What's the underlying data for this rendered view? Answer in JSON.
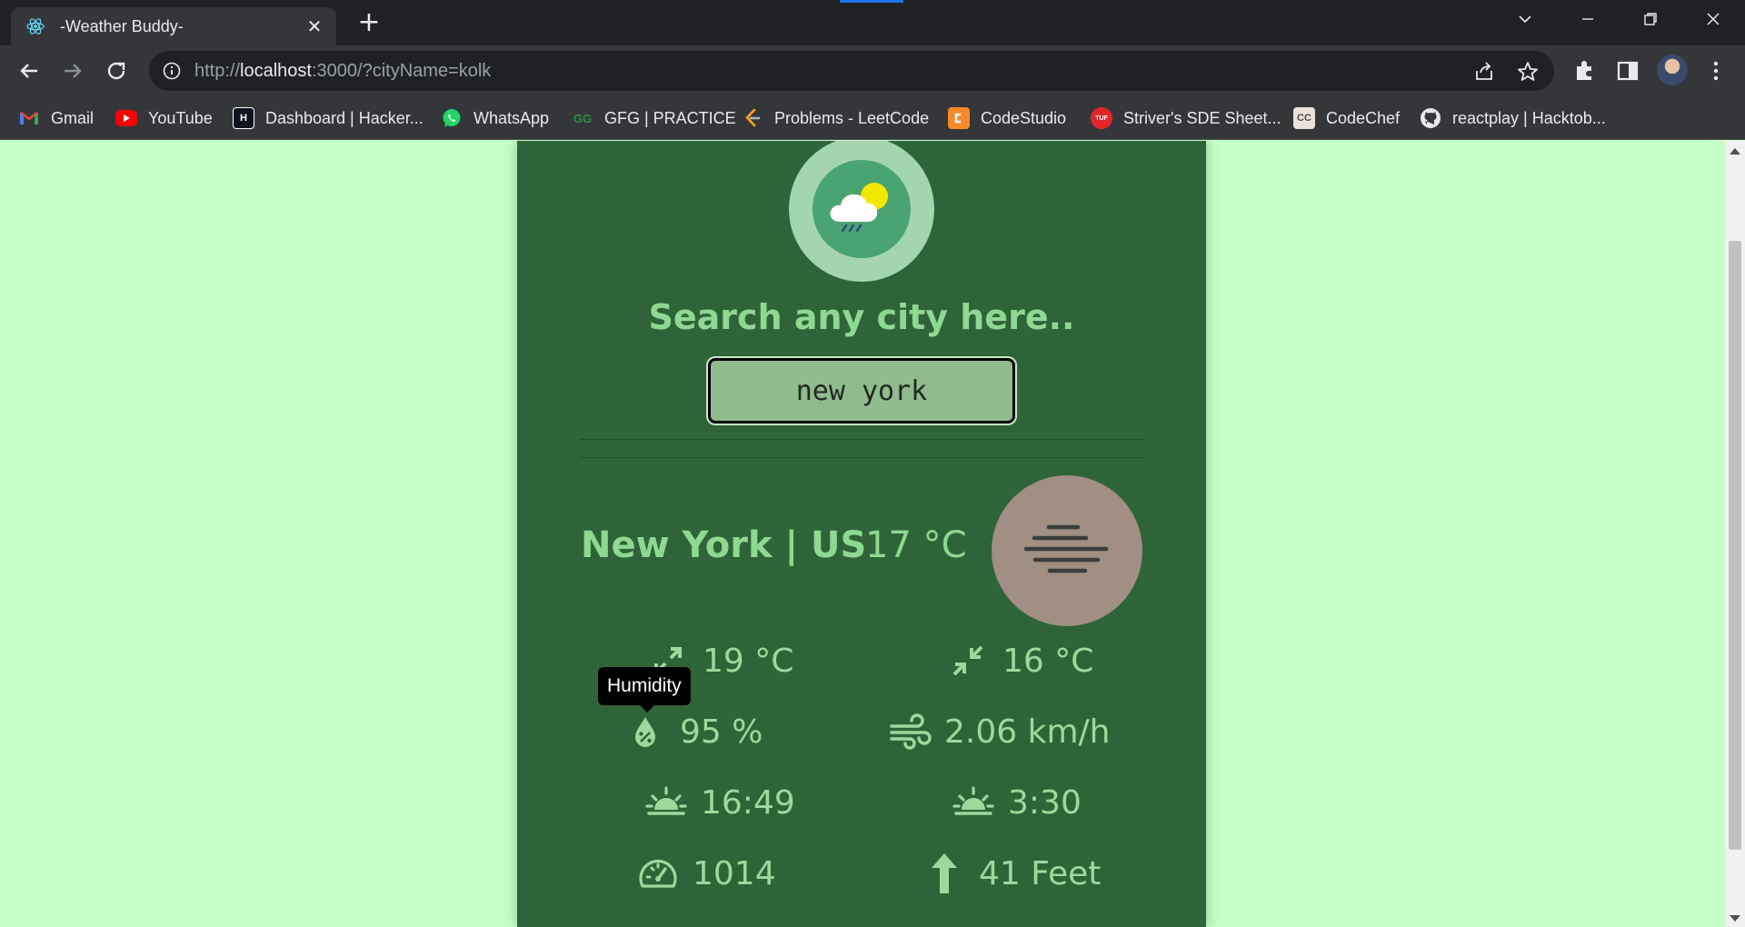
{
  "browser": {
    "tab_title": "-Weather Buddy-",
    "tab_close": "✕",
    "new_tab": "+",
    "url_prefix": "http://",
    "url_host": "localhost",
    "url_rest": ":3000/?cityName=kolk",
    "accent_color": "#1a73e8",
    "window_controls": [
      "minimize",
      "restore",
      "close"
    ]
  },
  "bookmarks": [
    {
      "label": "Gmail",
      "icon": "gmail-icon"
    },
    {
      "label": "YouTube",
      "icon": "youtube-icon"
    },
    {
      "label": "Dashboard | Hacker...",
      "icon": "hackerrank-icon",
      "icon_text": "H"
    },
    {
      "label": "WhatsApp",
      "icon": "whatsapp-icon"
    },
    {
      "label": "GFG | PRACTICE",
      "icon": "gfg-icon",
      "icon_text": "GG"
    },
    {
      "label": "Problems - LeetCode",
      "icon": "leetcode-icon"
    },
    {
      "label": "CodeStudio",
      "icon": "codestudio-icon"
    },
    {
      "label": "Striver's SDE Sheet...",
      "icon": "tuf-icon",
      "icon_text": "TUF"
    },
    {
      "label": "CodeChef",
      "icon": "codechef-icon",
      "icon_text": "CC"
    },
    {
      "label": "reactplay | Hacktob...",
      "icon": "github-icon"
    }
  ],
  "app": {
    "search_title": "Search any city here..",
    "search_value": "new york",
    "city": "New York | US",
    "temperature": "17 °C",
    "weather_icon": "mist-icon",
    "tooltip": "Humidity",
    "stats": {
      "temp_max": "19 °C",
      "temp_min": "16 °C",
      "humidity": "95 %",
      "wind": "2.06 km/h",
      "sunrise": "16:49",
      "sunset": "3:30",
      "pressure": "1014",
      "sea_level": "41 Feet"
    },
    "colors": {
      "page_bg": "#c6fec8",
      "card_bg": "#2f6438",
      "text_green": "#8fd892"
    }
  }
}
